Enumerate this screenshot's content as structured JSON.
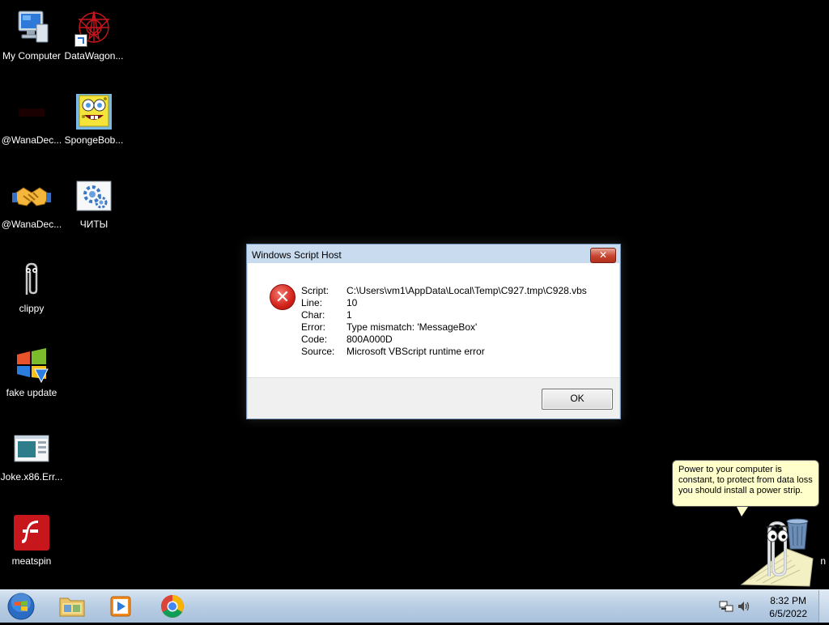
{
  "desktop_icons": [
    {
      "label": "My Computer",
      "icon": "computer-icon"
    },
    {
      "label": "DataWagon...",
      "icon": "datawagon-icon"
    },
    {
      "label": "@WanaDec...",
      "icon": "wanadecryptor-icon"
    },
    {
      "label": "SpongeBob...",
      "icon": "spongebob-icon"
    },
    {
      "label": "@WanaDec...",
      "icon": "handshake-icon"
    },
    {
      "label": "ЧИТЫ",
      "icon": "settings-gears-icon"
    },
    {
      "label": "clippy",
      "icon": "paperclip-icon"
    },
    {
      "label": "fake update",
      "icon": "windows-update-icon"
    },
    {
      "label": "Joke.x86.Err...",
      "icon": "window-app-icon"
    },
    {
      "label": "meatspin",
      "icon": "flash-icon"
    },
    {
      "label": "n",
      "icon": "recycle-bin-icon"
    }
  ],
  "dialog": {
    "title": "Windows Script Host",
    "close_label": "✕",
    "icon": "error-icon",
    "rows": [
      {
        "key": "Script:",
        "value": "C:\\Users\\vm1\\AppData\\Local\\Temp\\C927.tmp\\C928.vbs"
      },
      {
        "key": "Line:",
        "value": "10"
      },
      {
        "key": "Char:",
        "value": "1"
      },
      {
        "key": "Error:",
        "value": "Type mismatch: 'MessageBox'"
      },
      {
        "key": "Code:",
        "value": "800A000D"
      },
      {
        "key": "Source:",
        "value": "Microsoft VBScript runtime error"
      }
    ],
    "ok_label": "OK"
  },
  "clippy": {
    "message": "Power to your computer is constant, to protect from data loss you should install a power strip."
  },
  "taskbar": {
    "start_icon": "windows-orb-icon",
    "pinned": [
      {
        "name": "explorer",
        "icon": "folder-icon"
      },
      {
        "name": "media-player",
        "icon": "media-player-icon"
      },
      {
        "name": "chrome",
        "icon": "chrome-icon"
      }
    ],
    "clock": {
      "time": "8:32 PM",
      "date": "6/5/2022"
    },
    "tray_icons": [
      "network-icon",
      "volume-icon"
    ]
  },
  "colors": {
    "desktop_bg": "#000000",
    "dialog_frame": "#c9dcef",
    "error_red": "#d3221b",
    "bubble_bg": "#ffffcc"
  }
}
